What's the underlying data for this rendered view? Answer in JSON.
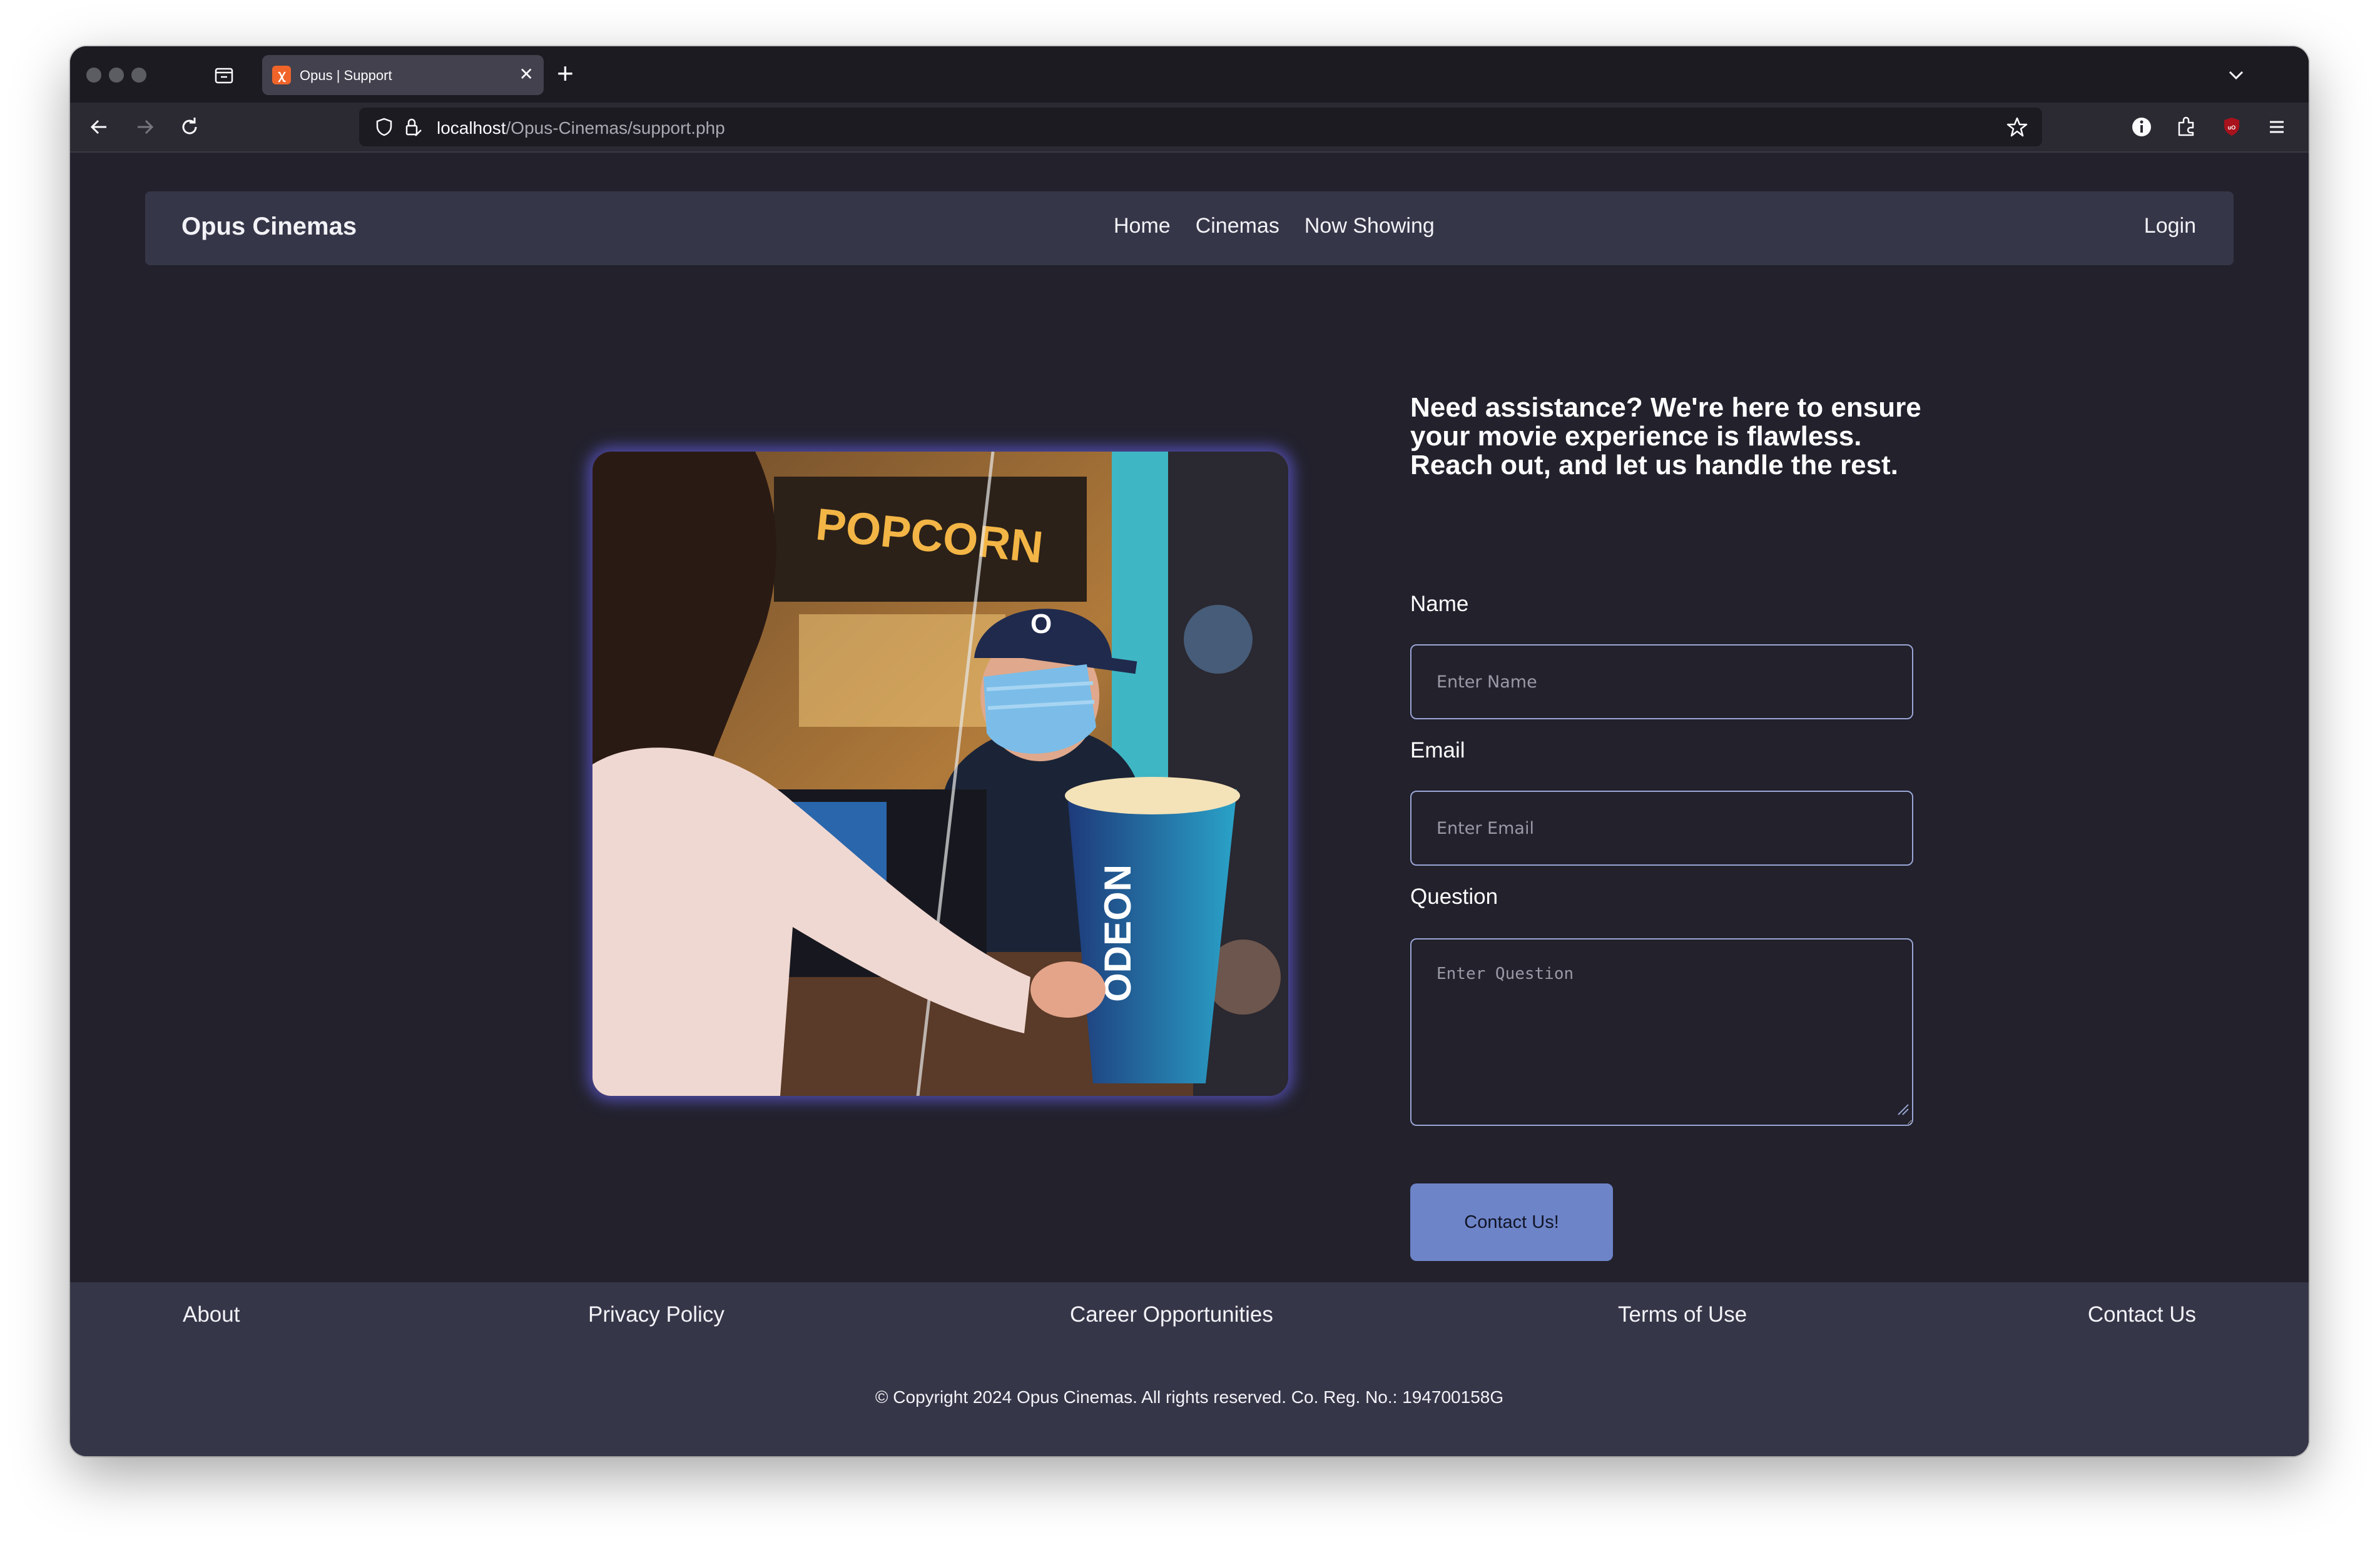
{
  "browser": {
    "tab_title": "Opus | Support",
    "tab_favicon": "xampp-icon",
    "url_host": "localhost",
    "url_path": "/Opus-Cinemas/support.php"
  },
  "site": {
    "brand": "Opus Cinemas",
    "nav": [
      "Home",
      "Cinemas",
      "Now Showing"
    ],
    "login": "Login"
  },
  "support": {
    "intro": "Need assistance? We're here to ensure your movie experience is flawless. Reach out, and let us handle the rest.",
    "image_text": {
      "popcorn_sign": "POPCORN",
      "cup_brand": "ODEON",
      "cap_letter": "O"
    },
    "name_label": "Name",
    "name_placeholder": "Enter Name",
    "email_label": "Email",
    "email_placeholder": "Enter Email",
    "question_label": "Question",
    "question_placeholder": "Enter Question",
    "submit_label": "Contact Us!"
  },
  "footer": {
    "links": [
      "About",
      "Privacy Policy",
      "Career Opportunities",
      "Terms of Use",
      "Contact Us"
    ],
    "copyright": "© Copyright 2024 Opus Cinemas. All rights reserved. Co. Reg. No.: 194700158G"
  },
  "colors": {
    "page_bg": "#22212c",
    "panel_bg": "#363649",
    "button_bg": "#6d84c8",
    "input_border": "#9aa6d4",
    "image_glow": "#5f5ad2"
  }
}
